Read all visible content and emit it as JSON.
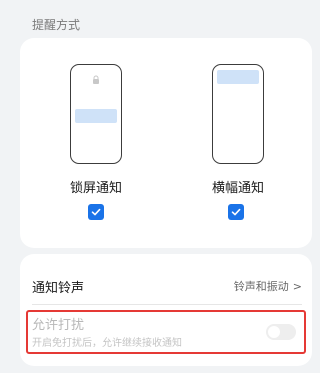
{
  "section": {
    "title": "提醒方式"
  },
  "options": [
    {
      "label": "锁屏通知",
      "checked": true
    },
    {
      "label": "横幅通知",
      "checked": true
    }
  ],
  "ringtone": {
    "label": "通知铃声",
    "value": "铃声和振动",
    "chevron": ">"
  },
  "dnd": {
    "title": "允许打扰",
    "subtitle": "开启免打扰后，允许继续接收通知",
    "enabled": false
  },
  "colors": {
    "accent": "#1a73e8",
    "highlight_border": "#e53935",
    "preview_bar": "#cfe2f8"
  },
  "icons": {
    "lock": "lock-icon",
    "check": "checkmark-icon",
    "chevron": "chevron-right-icon"
  }
}
